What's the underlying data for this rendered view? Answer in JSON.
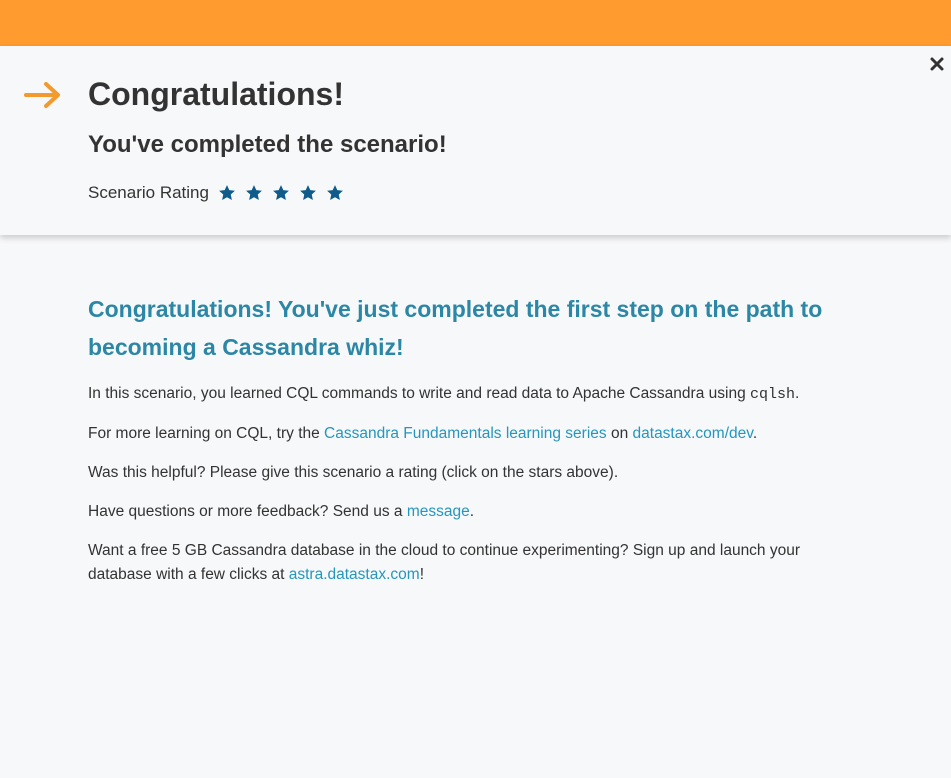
{
  "colors": {
    "top_bar": "#ff9b2f",
    "accent_arrow": "#f39a2f",
    "star": "#0f5b8c",
    "heading_teal": "#2c87a6",
    "link": "#2596be"
  },
  "header": {
    "title": "Congratulations!",
    "subtitle": "You've completed the scenario!",
    "rating_label": "Scenario Rating",
    "stars": [
      "star-icon",
      "star-icon",
      "star-icon",
      "star-icon",
      "star-icon"
    ],
    "close_icon": "close-icon",
    "arrow_icon": "arrow-right-icon"
  },
  "content": {
    "heading": "Congratulations! You've just completed the first step on the path to becoming a Cassandra whiz!",
    "p1": {
      "text": "In this scenario, you learned CQL commands to write and read data to Apache Cassandra using ",
      "code": "cqlsh",
      "end": "."
    },
    "p2": {
      "text": "For more learning on CQL, try the ",
      "link1": "Cassandra Fundamentals learning series",
      "mid": " on ",
      "link2": "datastax.com/dev",
      "end": "."
    },
    "p3": {
      "text": "Was this helpful? Please give this scenario a rating (click on the stars above)."
    },
    "p4": {
      "text": "Have questions or more feedback? Send us a ",
      "link": "message",
      "end": "."
    },
    "p5": {
      "text": "Want a free 5 GB Cassandra database in the cloud to continue experimenting? Sign up and launch your database with a few clicks at ",
      "link": "astra.datastax.com",
      "end": "!"
    }
  }
}
